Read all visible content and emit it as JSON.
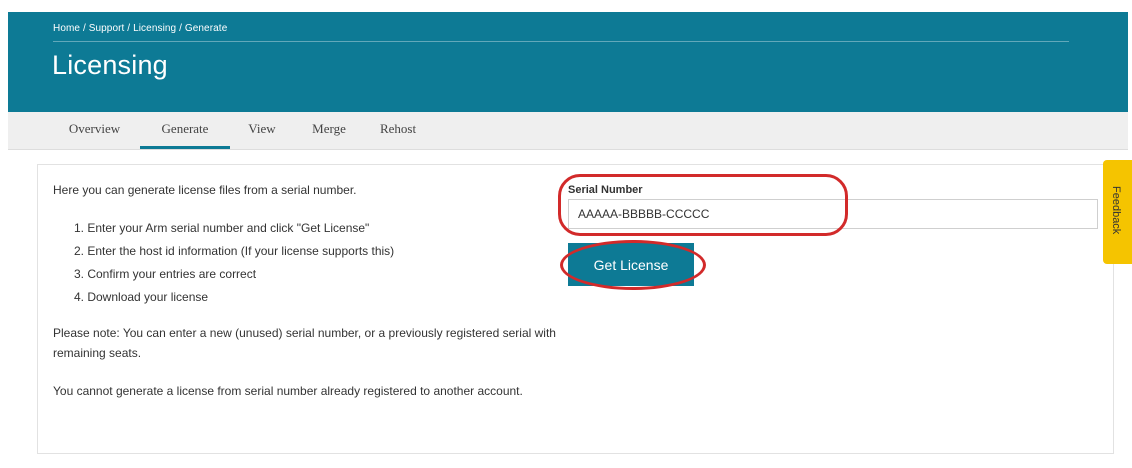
{
  "header": {
    "breadcrumb": "Home / Support / Licensing / Generate",
    "title": "Licensing"
  },
  "tabs": [
    {
      "label": "Overview",
      "active": false
    },
    {
      "label": "Generate",
      "active": true
    },
    {
      "label": "View",
      "active": false
    },
    {
      "label": "Merge",
      "active": false
    },
    {
      "label": "Rehost",
      "active": false
    }
  ],
  "content": {
    "intro": "Here you can generate license files from a serial number.",
    "steps": [
      "1. Enter your Arm serial number and click \"Get License\"",
      "2. Enter the host id information (If your license supports this)",
      "3. Confirm your entries are correct",
      "4. Download your license"
    ],
    "note_unused": "Please note: You can enter a new (unused) serial number, or a previously registered serial with remaining seats.",
    "note_registered": "You cannot generate a license from serial number already registered to another account."
  },
  "form": {
    "serial_label": "Serial Number",
    "serial_value": "AAAAA-BBBBB-CCCCC",
    "submit_label": "Get License"
  },
  "feedback": {
    "label": "Feedback"
  },
  "colors": {
    "brand_teal": "#0d7a95",
    "annotation_red": "#d22a2a",
    "feedback_yellow": "#f5c400"
  }
}
